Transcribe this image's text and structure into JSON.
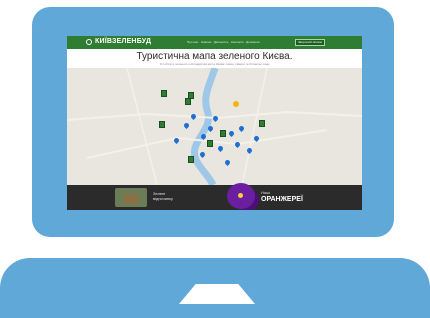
{
  "site": {
    "logo": "КИЇВЗЕЛЕНБУД",
    "nav": "Про нас · Новини · Діяльність · Контакти · Допомога",
    "cta": "Зворотній зв'язок"
  },
  "hero": {
    "headline": "Туристична мапа зеленого Києва.",
    "subline": "Усі об'єкти зеленого господарства міста Києва: парки, сквери та ботанічні сади"
  },
  "promo": {
    "left_label_1": "Зелені",
    "left_label_2": "відпочинку",
    "right_small": "Наші",
    "right_big": "ОРАНЖЕРЕЇ"
  },
  "colors": {
    "frame": "#5fa8d8",
    "header": "#2e7d32",
    "map_background": "#e9e6df",
    "river": "#9ec7e8",
    "marker_blue": "#1f6fd1",
    "marker_green": "#2e7d32",
    "promo_bar": "#2b2b2b"
  }
}
